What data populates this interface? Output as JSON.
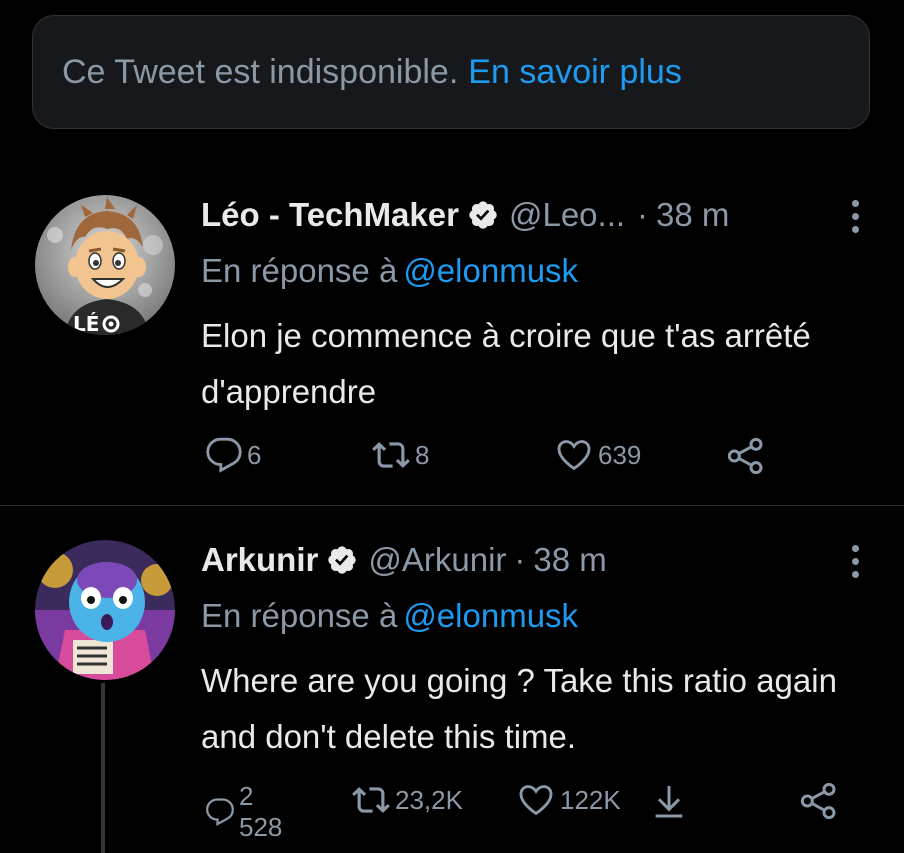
{
  "unavailable": {
    "message": "Ce Tweet est indisponible.",
    "link": "En savoir plus"
  },
  "tweets": [
    {
      "name": "Léo - TechMaker",
      "handle": "@Leo...",
      "dot": "·",
      "time": "38 m",
      "reply_prefix": "En réponse à",
      "reply_mention": "@elonmusk",
      "text": "Elon je commence à croire que t'as arrêté d'apprendre",
      "replies": "6",
      "retweets": "8",
      "likes": "639",
      "avatar_badge": "LÉ"
    },
    {
      "name": "Arkunir",
      "handle": "@Arkunir",
      "dot": "·",
      "time": "38 m",
      "reply_prefix": "En réponse à",
      "reply_mention": "@elonmusk",
      "text": "Where are you going ? Take this ratio again and don't delete this time.",
      "replies": "2 528",
      "retweets": "23,2K",
      "likes": "122K"
    }
  ],
  "colors": {
    "background": "#000000",
    "accent": "#1d9bf0",
    "muted": "#8b98a5",
    "text": "#e7e9ea",
    "card": "#16181c"
  }
}
